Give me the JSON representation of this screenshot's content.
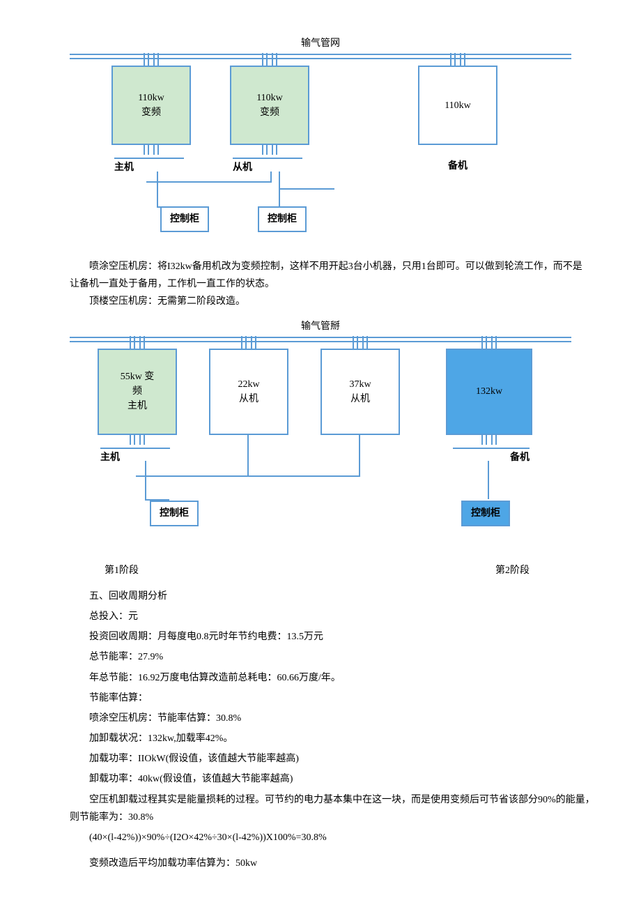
{
  "diagram1": {
    "title": "输气管网",
    "boxes": [
      {
        "line1": "110kw",
        "line2": "变频",
        "role": "主机"
      },
      {
        "line1": "110kw",
        "line2": "变频",
        "role": "从机"
      },
      {
        "line1": "110kw",
        "line2": "",
        "role": "备机"
      }
    ],
    "ctrl": "控制柜"
  },
  "para1": "喷涂空压机房：将I32kw备用机改为变频控制，这样不用开起3台小机器，只用1台即可。可以做到轮流工作，而不是让备机一直处于备用，工作机一直工作的状态。",
  "para2": "顶楼空压机房：无需第二阶段改造。",
  "diagram2": {
    "title": "输气管掰",
    "boxes": [
      {
        "line1": "55kw 变",
        "line2": "频",
        "line3": "主机",
        "role": "主机"
      },
      {
        "line1": "22kw",
        "line2": "从机",
        "role": ""
      },
      {
        "line1": "37kw",
        "line2": "从机",
        "role": ""
      },
      {
        "line1": "132kw",
        "line2": "",
        "role": "备机"
      }
    ],
    "ctrl": "控制柜"
  },
  "phase1": "第1阶段",
  "phase2": "第2阶段",
  "section5": "五、回收周期分析",
  "lines": {
    "l1": "总投入：元",
    "l2": "投资回收周期：月每度电0.8元时年节约电费：13.5万元",
    "l3": "总节能率：27.9%",
    "l4": "年总节能：16.92万度电估算改造前总耗电：60.66万度/年。",
    "l5": "节能率估算：",
    "l6": "喷涂空压机房：节能率估算：30.8%",
    "l7": "加卸载状况：132kw,加载率42%。",
    "l8": "加载功率：IIOkW(假设值，该值越大节能率越高)",
    "l9": "卸载功率：40kw(假设值，该值越大节能率越高)",
    "l10": "空压机卸载过程其实是能量损耗的过程。可节约的电力基本集中在这一块，而是使用变频后可节省该部分90%的能量，则节能率为：30.8%",
    "formula": "(40×(l-42%))×90%÷(I2O×42%÷30×(l-42%))X100%=30.8%",
    "l11": "变频改造后平均加载功率估算为：50kw"
  }
}
